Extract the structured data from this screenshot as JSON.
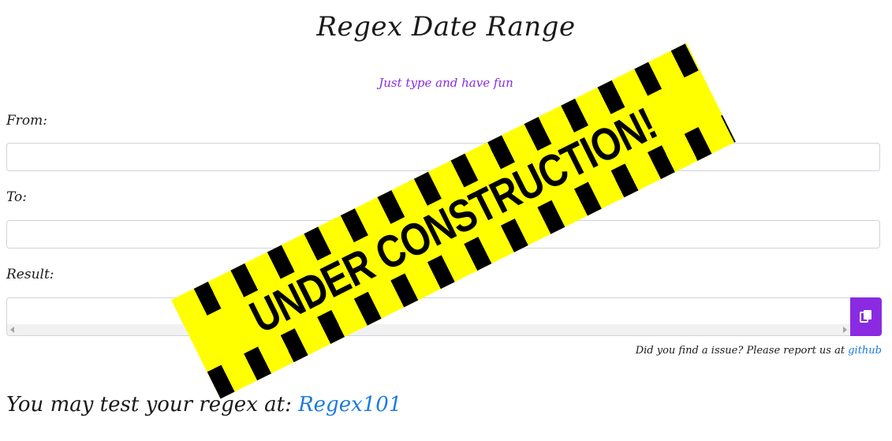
{
  "page": {
    "title": "Regex Date Range",
    "subtitle": "Just type and have fun"
  },
  "form": {
    "from_label": "From:",
    "from_value": "",
    "to_label": "To:",
    "to_value": "",
    "result_label": "Result:",
    "result_value": ""
  },
  "copy_button": {
    "icon": "copy-icon"
  },
  "report": {
    "text": "Did you find a issue? Please report us at ",
    "link_label": "github"
  },
  "test": {
    "text": "You may test your regex at: ",
    "link_label": "Regex101"
  },
  "banner": {
    "text": "UNDER CONSTRUCTION!"
  },
  "colors": {
    "accent": "#8a2be2",
    "link": "#1b7be0",
    "banner_yellow": "#ffff00"
  }
}
